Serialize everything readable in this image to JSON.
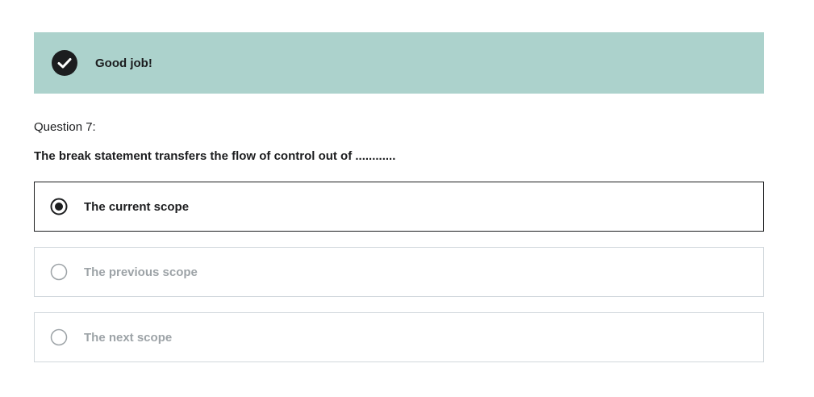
{
  "banner": {
    "icon": "check-circle-icon",
    "message": "Good job!",
    "background_color": "#acd2cc"
  },
  "question": {
    "label": "Question 7:",
    "text": "The break statement transfers the flow of control out of ............"
  },
  "options": [
    {
      "label": "The current scope",
      "selected": true
    },
    {
      "label": "The previous scope",
      "selected": false
    },
    {
      "label": "The next scope",
      "selected": false
    }
  ]
}
